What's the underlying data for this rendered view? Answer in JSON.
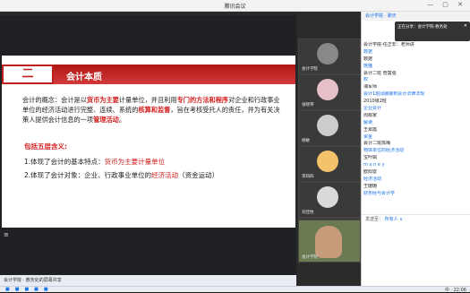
{
  "window": {
    "title": "腾讯会议"
  },
  "slide": {
    "section_number": "二",
    "section_title": "会计本质",
    "concept_intro": "会计的概念：",
    "concept_p1": "会计是以",
    "concept_r1": "货币为主要",
    "concept_p2": "计量单位，并且利用",
    "concept_r2": "专门的方法和程序",
    "concept_p3": "对企业和行政事业单位的经济活动进行完整、连续、系统的",
    "concept_r3": "核算和监督",
    "concept_p4": "，旨在考核受托人的责任，并为有关决策人提供会计信息的一项",
    "concept_r4": "管理活动",
    "concept_p5": "。",
    "red_heading": "包括五层含义:",
    "point1_prefix": "1.体现了会计的基本特点：",
    "point1_red": "货币为主要计量单位",
    "point2_prefix": "2.体现了会计对象：企业、行政事业单位的",
    "point2_red": "经济活动",
    "point2_suffix": "（资金运动）"
  },
  "participants": [
    {
      "name": "会计学院",
      "color": "#888888"
    },
    {
      "name": "张晓琴",
      "color": "#e6c0c8"
    },
    {
      "name": "杨敏",
      "color": "#cccccc"
    },
    {
      "name": "李四四",
      "color": "#f3c26b"
    },
    {
      "name": "刘佳怡",
      "color": "#d9d9d9"
    },
    {
      "name": "宋立华",
      "color": "#e8e8e8"
    },
    {
      "name": "会计学院",
      "color": "#c89b7b"
    }
  ],
  "chat": {
    "tab": "会计学院 · 聊天",
    "popup_text": "正在分享：会计学院-教务处",
    "popup_close": "✕",
    "lines": [
      "会计学院-任正非：老师讲",
      "数据",
      "数据",
      "熊猫",
      "会计二班 管富强",
      "权",
      "湘军师",
      "会计1班邱娜娜到会计法律法规",
      "2010级2班",
      "企业会计",
      "周顺家",
      "解读",
      "王翠霞",
      "资金",
      "会计二班陈梅",
      "物体单位的经济活动",
      "宝叶娟",
      "m o n e y",
      "欧阳雷",
      "经济活动",
      "王珊珊",
      "财务经与会计学"
    ],
    "send_label": "发送至：",
    "send_target": "所有人 ∨"
  },
  "share_bottom_icon": "≡",
  "bottom_status": "会计学院 · 教务处的屏幕共享",
  "taskbar": {
    "tray": "中 · 22:06"
  }
}
